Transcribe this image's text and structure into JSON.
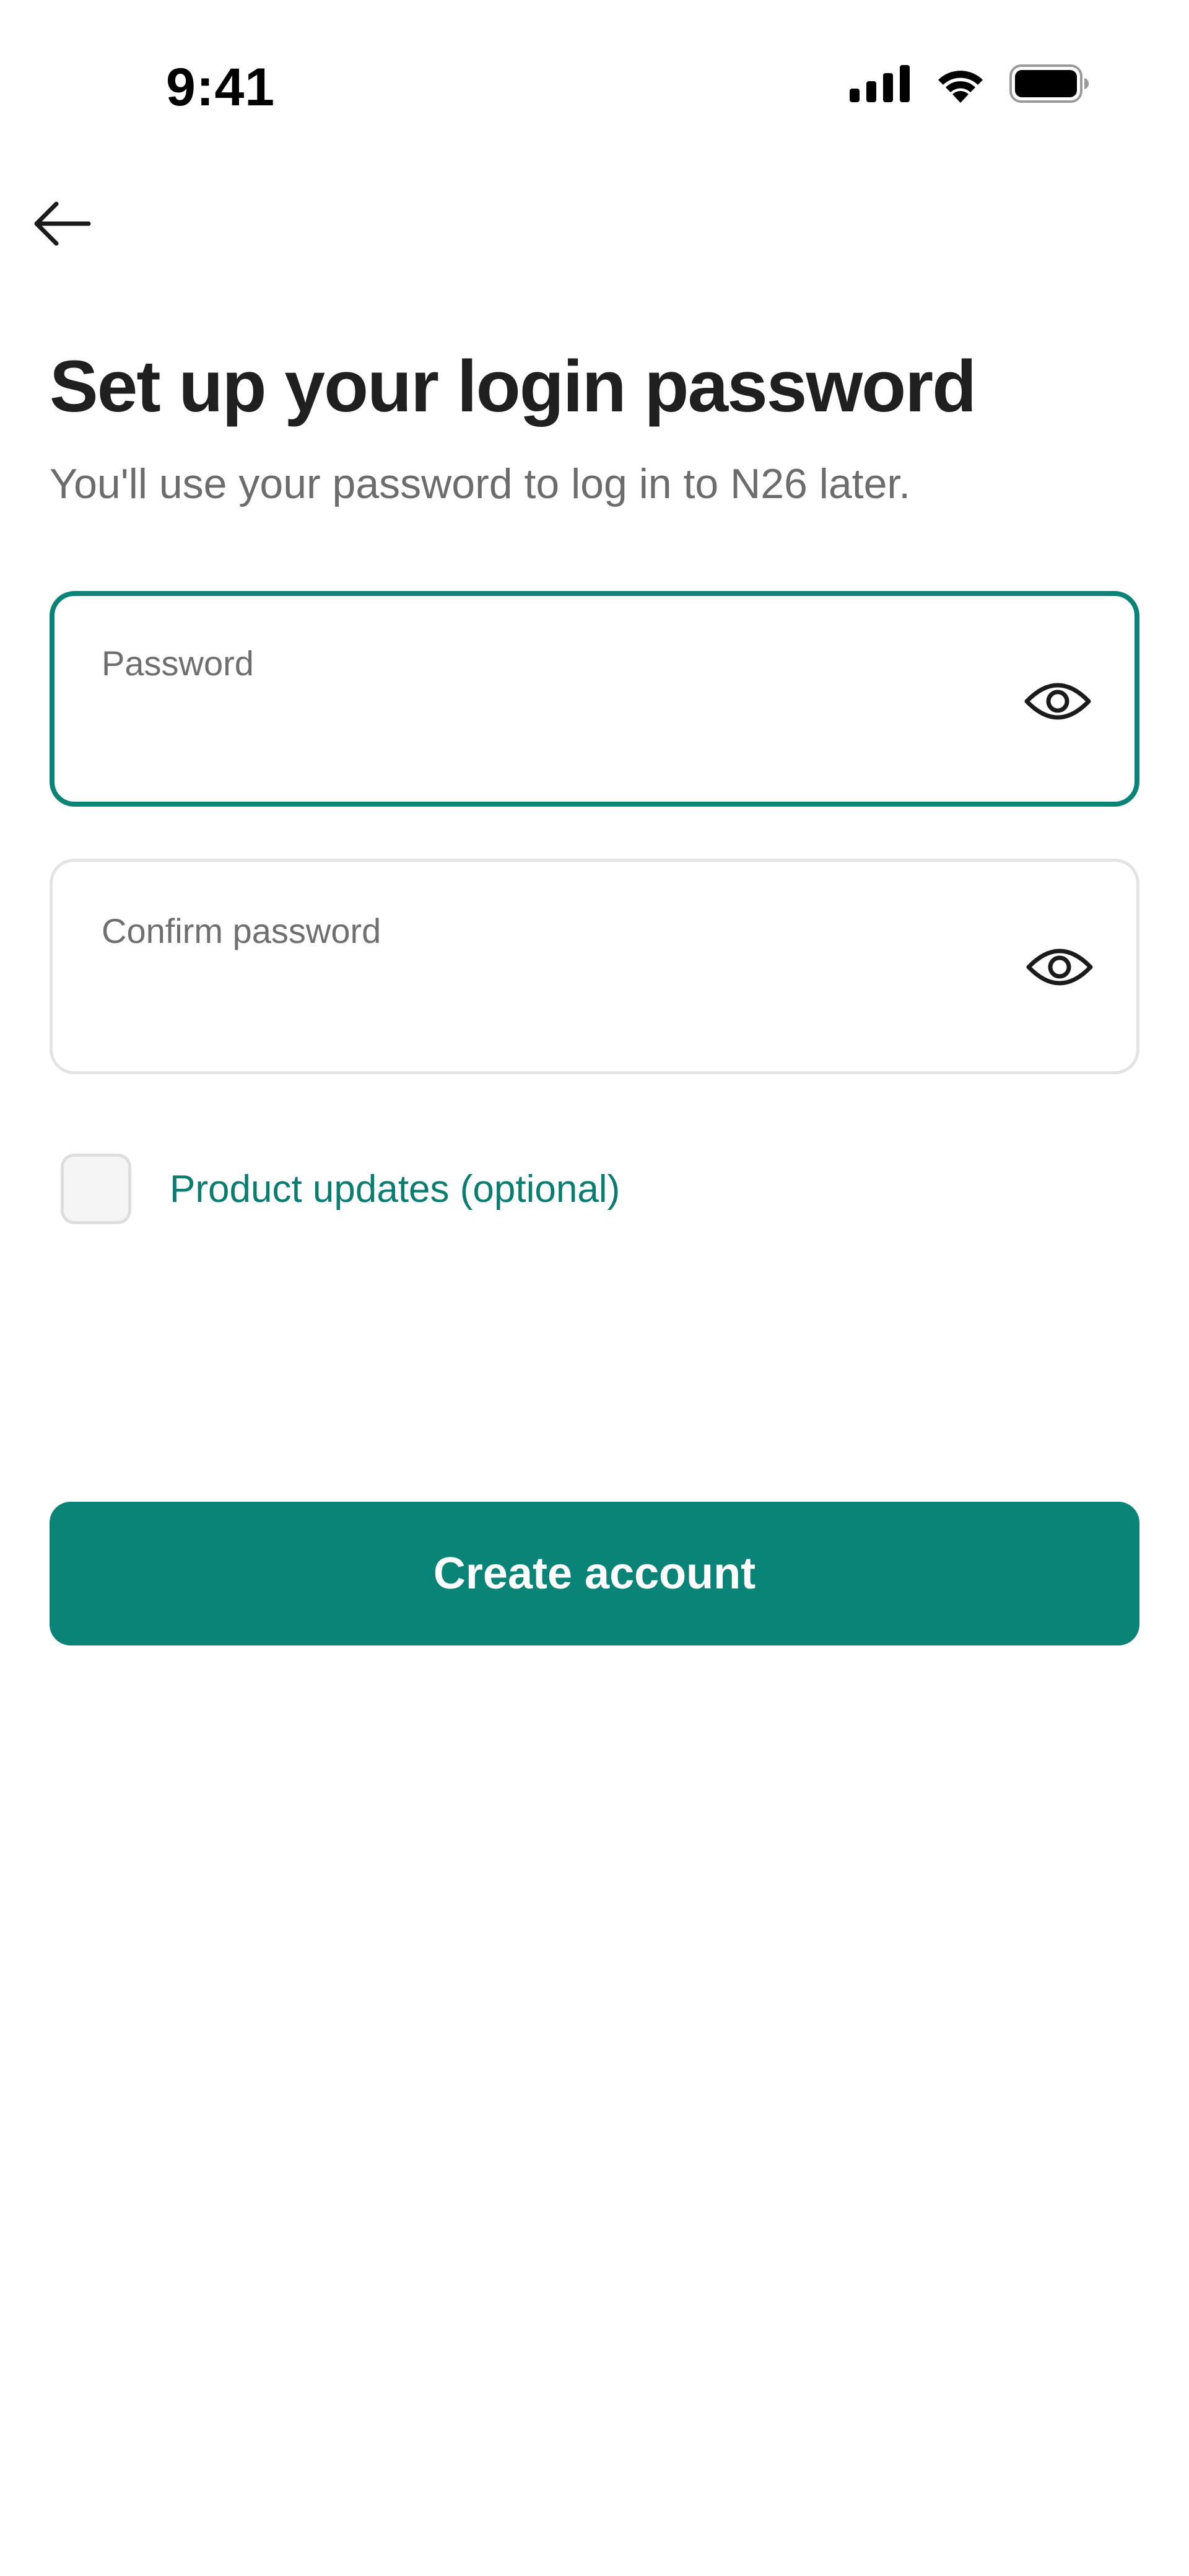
{
  "status_bar": {
    "time": "9:41",
    "icons": [
      "cellular-signal-icon",
      "wifi-icon",
      "battery-icon"
    ]
  },
  "nav": {
    "back_icon": "arrow-left-icon"
  },
  "header": {
    "title": "Set up your login password",
    "subtitle": "You'll use your password to log in to N26 later."
  },
  "fields": {
    "password": {
      "label": "Password",
      "value": "",
      "state": "focused",
      "toggle_icon": "eye-icon"
    },
    "confirm_password": {
      "label": "Confirm password",
      "value": "",
      "state": "idle",
      "toggle_icon": "eye-icon"
    }
  },
  "product_updates": {
    "label": "Product updates (optional)",
    "checked": false
  },
  "primary_action": {
    "label": "Create account"
  },
  "colors": {
    "accent": "#0b8478",
    "focus_border": "#0b8477",
    "link_text": "#0b7d70",
    "title_text": "#1f1f1f",
    "secondary_text": "#6c6c6c",
    "field_border_idle": "#e3e3e3",
    "checkbox_fill": "#f4f5f4",
    "background": "#ffffff"
  }
}
